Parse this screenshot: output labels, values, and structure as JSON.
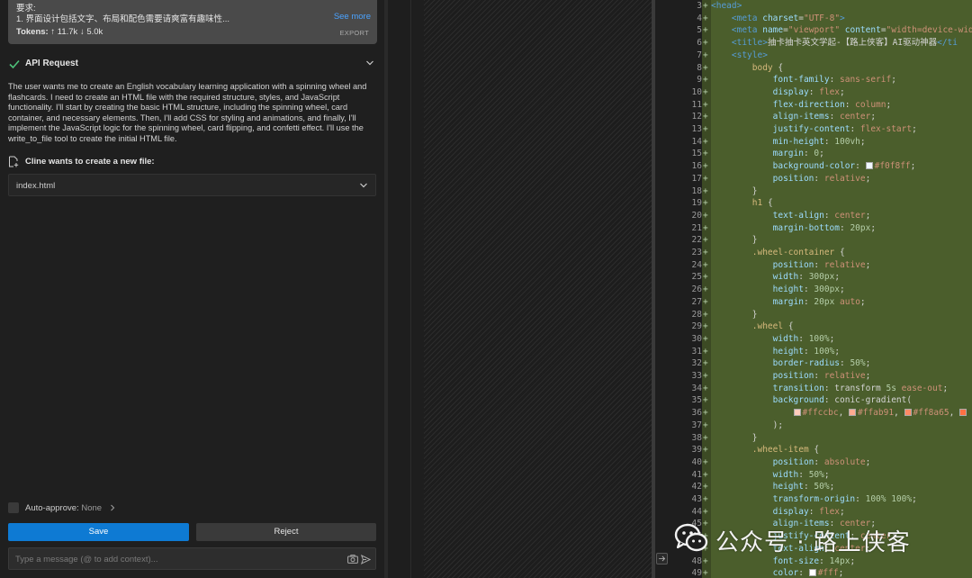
{
  "task": {
    "requirement_label": "要求:",
    "requirement_line": "1. 界面设计包括文字、布局和配色需要请爽富有趣味性...",
    "see_more": "See more",
    "tokens_label": "Tokens:",
    "tokens_up": "↑ 11.7k",
    "tokens_down": "↓ 5.0k",
    "export": "EXPORT"
  },
  "api_request": {
    "title": "API Request",
    "status_icon": "check-icon",
    "text": "The user wants me to create an English vocabulary learning application with a spinning wheel and flashcards. I need to create an HTML file with the required structure, styles, and JavaScript functionality. I'll start by creating the basic HTML structure, including the spinning wheel, card container, and necessary elements. Then, I'll add CSS for styling and animations, and finally, I'll implement the JavaScript logic for the spinning wheel, card flipping, and confetti effect. I'll use the write_to_file tool to create the initial HTML file."
  },
  "new_file": {
    "title": "Cline wants to create a new file:",
    "filename": "index.html"
  },
  "auto_approve": {
    "label": "Auto-approve:",
    "value": "None"
  },
  "actions": {
    "save": "Save",
    "reject": "Reject"
  },
  "message": {
    "placeholder": "Type a message (@ to add context)..."
  },
  "colors": {
    "accent": "#0e7ad3",
    "added_line": "#4b5e2c",
    "check": "#4ec27a",
    "link": "#4aa3ff"
  },
  "code": [
    {
      "n": "3+",
      "tokens": [
        [
          "t-tag",
          "<head>"
        ]
      ]
    },
    {
      "n": "4+",
      "tokens": [
        [
          "t-text",
          "    "
        ],
        [
          "t-tag",
          "<meta "
        ],
        [
          "t-attr",
          "charset"
        ],
        [
          "t-punc",
          "="
        ],
        [
          "t-str",
          "\"UTF-8\""
        ],
        [
          "t-tag",
          ">"
        ]
      ]
    },
    {
      "n": "5+",
      "tokens": [
        [
          "t-text",
          "    "
        ],
        [
          "t-tag",
          "<meta "
        ],
        [
          "t-attr",
          "name"
        ],
        [
          "t-punc",
          "="
        ],
        [
          "t-str",
          "\"viewport\" "
        ],
        [
          "t-attr",
          "content"
        ],
        [
          "t-punc",
          "="
        ],
        [
          "t-str",
          "\"width=device-wid"
        ]
      ]
    },
    {
      "n": "6+",
      "tokens": [
        [
          "t-text",
          "    "
        ],
        [
          "t-tag",
          "<title>"
        ],
        [
          "t-text",
          "抽卡抽卡英文学起-【路上侠客】AI驱动神器"
        ],
        [
          "t-tag",
          "</ti"
        ]
      ]
    },
    {
      "n": "7+",
      "tokens": [
        [
          "t-text",
          "    "
        ],
        [
          "t-tag",
          "<style>"
        ]
      ]
    },
    {
      "n": "8+",
      "tokens": [
        [
          "t-text",
          "        "
        ],
        [
          "t-sel",
          "body"
        ],
        [
          "t-punc",
          " {"
        ]
      ]
    },
    {
      "n": "9+",
      "tokens": [
        [
          "t-text",
          "            "
        ],
        [
          "t-prop",
          "font-family"
        ],
        [
          "t-punc",
          ": "
        ],
        [
          "t-val",
          "sans-serif"
        ],
        [
          "t-punc",
          ";"
        ]
      ]
    },
    {
      "n": "10+",
      "tokens": [
        [
          "t-text",
          "            "
        ],
        [
          "t-prop",
          "display"
        ],
        [
          "t-punc",
          ": "
        ],
        [
          "t-val",
          "flex"
        ],
        [
          "t-punc",
          ";"
        ]
      ]
    },
    {
      "n": "11+",
      "tokens": [
        [
          "t-text",
          "            "
        ],
        [
          "t-prop",
          "flex-direction"
        ],
        [
          "t-punc",
          ": "
        ],
        [
          "t-val",
          "column"
        ],
        [
          "t-punc",
          ";"
        ]
      ]
    },
    {
      "n": "12+",
      "tokens": [
        [
          "t-text",
          "            "
        ],
        [
          "t-prop",
          "align-items"
        ],
        [
          "t-punc",
          ": "
        ],
        [
          "t-val",
          "center"
        ],
        [
          "t-punc",
          ";"
        ]
      ]
    },
    {
      "n": "13+",
      "tokens": [
        [
          "t-text",
          "            "
        ],
        [
          "t-prop",
          "justify-content"
        ],
        [
          "t-punc",
          ": "
        ],
        [
          "t-val",
          "flex-start"
        ],
        [
          "t-punc",
          ";"
        ]
      ]
    },
    {
      "n": "14+",
      "tokens": [
        [
          "t-text",
          "            "
        ],
        [
          "t-prop",
          "min-height"
        ],
        [
          "t-punc",
          ": "
        ],
        [
          "t-num",
          "100vh"
        ],
        [
          "t-punc",
          ";"
        ]
      ]
    },
    {
      "n": "15+",
      "tokens": [
        [
          "t-text",
          "            "
        ],
        [
          "t-prop",
          "margin"
        ],
        [
          "t-punc",
          ": "
        ],
        [
          "t-num",
          "0"
        ],
        [
          "t-punc",
          ";"
        ]
      ]
    },
    {
      "n": "16+",
      "tokens": [
        [
          "t-text",
          "            "
        ],
        [
          "t-prop",
          "background-color"
        ],
        [
          "t-punc",
          ": "
        ],
        [
          "swatch",
          "#f0f8ff"
        ],
        [
          "t-val",
          "#f0f8ff"
        ],
        [
          "t-punc",
          ";"
        ]
      ]
    },
    {
      "n": "17+",
      "tokens": [
        [
          "t-text",
          "            "
        ],
        [
          "t-prop",
          "position"
        ],
        [
          "t-punc",
          ": "
        ],
        [
          "t-val",
          "relative"
        ],
        [
          "t-punc",
          ";"
        ]
      ]
    },
    {
      "n": "18+",
      "tokens": [
        [
          "t-text",
          "        "
        ],
        [
          "t-punc",
          "}"
        ]
      ]
    },
    {
      "n": "19+",
      "tokens": [
        [
          "t-text",
          "        "
        ],
        [
          "t-sel",
          "h1"
        ],
        [
          "t-punc",
          " {"
        ]
      ]
    },
    {
      "n": "20+",
      "tokens": [
        [
          "t-text",
          "            "
        ],
        [
          "t-prop",
          "text-align"
        ],
        [
          "t-punc",
          ": "
        ],
        [
          "t-val",
          "center"
        ],
        [
          "t-punc",
          ";"
        ]
      ]
    },
    {
      "n": "21+",
      "tokens": [
        [
          "t-text",
          "            "
        ],
        [
          "t-prop",
          "margin-bottom"
        ],
        [
          "t-punc",
          ": "
        ],
        [
          "t-num",
          "20px"
        ],
        [
          "t-punc",
          ";"
        ]
      ]
    },
    {
      "n": "22+",
      "tokens": [
        [
          "t-text",
          "        "
        ],
        [
          "t-punc",
          "}"
        ]
      ]
    },
    {
      "n": "23+",
      "tokens": [
        [
          "t-text",
          "        "
        ],
        [
          "t-sel",
          ".wheel-container"
        ],
        [
          "t-punc",
          " {"
        ]
      ]
    },
    {
      "n": "24+",
      "tokens": [
        [
          "t-text",
          "            "
        ],
        [
          "t-prop",
          "position"
        ],
        [
          "t-punc",
          ": "
        ],
        [
          "t-val",
          "relative"
        ],
        [
          "t-punc",
          ";"
        ]
      ]
    },
    {
      "n": "25+",
      "tokens": [
        [
          "t-text",
          "            "
        ],
        [
          "t-prop",
          "width"
        ],
        [
          "t-punc",
          ": "
        ],
        [
          "t-num",
          "300px"
        ],
        [
          "t-punc",
          ";"
        ]
      ]
    },
    {
      "n": "26+",
      "tokens": [
        [
          "t-text",
          "            "
        ],
        [
          "t-prop",
          "height"
        ],
        [
          "t-punc",
          ": "
        ],
        [
          "t-num",
          "300px"
        ],
        [
          "t-punc",
          ";"
        ]
      ]
    },
    {
      "n": "27+",
      "tokens": [
        [
          "t-text",
          "            "
        ],
        [
          "t-prop",
          "margin"
        ],
        [
          "t-punc",
          ": "
        ],
        [
          "t-num",
          "20px "
        ],
        [
          "t-val",
          "auto"
        ],
        [
          "t-punc",
          ";"
        ]
      ]
    },
    {
      "n": "28+",
      "tokens": [
        [
          "t-text",
          "        "
        ],
        [
          "t-punc",
          "}"
        ]
      ]
    },
    {
      "n": "29+",
      "tokens": [
        [
          "t-text",
          "        "
        ],
        [
          "t-sel",
          ".wheel"
        ],
        [
          "t-punc",
          " {"
        ]
      ]
    },
    {
      "n": "30+",
      "tokens": [
        [
          "t-text",
          "            "
        ],
        [
          "t-prop",
          "width"
        ],
        [
          "t-punc",
          ": "
        ],
        [
          "t-num",
          "100%"
        ],
        [
          "t-punc",
          ";"
        ]
      ]
    },
    {
      "n": "31+",
      "tokens": [
        [
          "t-text",
          "            "
        ],
        [
          "t-prop",
          "height"
        ],
        [
          "t-punc",
          ": "
        ],
        [
          "t-num",
          "100%"
        ],
        [
          "t-punc",
          ";"
        ]
      ]
    },
    {
      "n": "32+",
      "tokens": [
        [
          "t-text",
          "            "
        ],
        [
          "t-prop",
          "border-radius"
        ],
        [
          "t-punc",
          ": "
        ],
        [
          "t-num",
          "50%"
        ],
        [
          "t-punc",
          ";"
        ]
      ]
    },
    {
      "n": "33+",
      "tokens": [
        [
          "t-text",
          "            "
        ],
        [
          "t-prop",
          "position"
        ],
        [
          "t-punc",
          ": "
        ],
        [
          "t-val",
          "relative"
        ],
        [
          "t-punc",
          ";"
        ]
      ]
    },
    {
      "n": "34+",
      "tokens": [
        [
          "t-text",
          "            "
        ],
        [
          "t-prop",
          "transition"
        ],
        [
          "t-punc",
          ": "
        ],
        [
          "t-text",
          "transform "
        ],
        [
          "t-num",
          "5s "
        ],
        [
          "t-val",
          "ease-out"
        ],
        [
          "t-punc",
          ";"
        ]
      ]
    },
    {
      "n": "35+",
      "tokens": [
        [
          "t-text",
          "            "
        ],
        [
          "t-prop",
          "background"
        ],
        [
          "t-punc",
          ": "
        ],
        [
          "t-text",
          "conic-gradient("
        ]
      ]
    },
    {
      "n": "36+",
      "tokens": [
        [
          "t-text",
          "                "
        ],
        [
          "swatch",
          "#ffccbc"
        ],
        [
          "t-val",
          "#ffccbc"
        ],
        [
          "t-punc",
          ", "
        ],
        [
          "swatch",
          "#ffab91"
        ],
        [
          "t-val",
          "#ffab91"
        ],
        [
          "t-punc",
          ", "
        ],
        [
          "swatch",
          "#ff8a65"
        ],
        [
          "t-val",
          "#ff8a65"
        ],
        [
          "t-punc",
          ", "
        ],
        [
          "swatch",
          "#ff7043"
        ]
      ]
    },
    {
      "n": "37+",
      "tokens": [
        [
          "t-text",
          "            "
        ],
        [
          "t-punc",
          ");"
        ]
      ]
    },
    {
      "n": "38+",
      "tokens": [
        [
          "t-text",
          "        "
        ],
        [
          "t-punc",
          "}"
        ]
      ]
    },
    {
      "n": "39+",
      "tokens": [
        [
          "t-text",
          "        "
        ],
        [
          "t-sel",
          ".wheel-item"
        ],
        [
          "t-punc",
          " {"
        ]
      ]
    },
    {
      "n": "40+",
      "tokens": [
        [
          "t-text",
          "            "
        ],
        [
          "t-prop",
          "position"
        ],
        [
          "t-punc",
          ": "
        ],
        [
          "t-val",
          "absolute"
        ],
        [
          "t-punc",
          ";"
        ]
      ]
    },
    {
      "n": "41+",
      "tokens": [
        [
          "t-text",
          "            "
        ],
        [
          "t-prop",
          "width"
        ],
        [
          "t-punc",
          ": "
        ],
        [
          "t-num",
          "50%"
        ],
        [
          "t-punc",
          ";"
        ]
      ]
    },
    {
      "n": "42+",
      "tokens": [
        [
          "t-text",
          "            "
        ],
        [
          "t-prop",
          "height"
        ],
        [
          "t-punc",
          ": "
        ],
        [
          "t-num",
          "50%"
        ],
        [
          "t-punc",
          ";"
        ]
      ]
    },
    {
      "n": "43+",
      "tokens": [
        [
          "t-text",
          "            "
        ],
        [
          "t-prop",
          "transform-origin"
        ],
        [
          "t-punc",
          ": "
        ],
        [
          "t-num",
          "100% 100%"
        ],
        [
          "t-punc",
          ";"
        ]
      ]
    },
    {
      "n": "44+",
      "tokens": [
        [
          "t-text",
          "            "
        ],
        [
          "t-prop",
          "display"
        ],
        [
          "t-punc",
          ": "
        ],
        [
          "t-val",
          "flex"
        ],
        [
          "t-punc",
          ";"
        ]
      ]
    },
    {
      "n": "45+",
      "tokens": [
        [
          "t-text",
          "            "
        ],
        [
          "t-prop",
          "align-items"
        ],
        [
          "t-punc",
          ": "
        ],
        [
          "t-val",
          "center"
        ],
        [
          "t-punc",
          ";"
        ]
      ]
    },
    {
      "n": "46+",
      "tokens": [
        [
          "t-text",
          "            "
        ],
        [
          "t-prop",
          "justify-content"
        ],
        [
          "t-punc",
          ": "
        ],
        [
          "t-val",
          "center"
        ],
        [
          "t-punc",
          ";"
        ]
      ]
    },
    {
      "n": "47+",
      "tokens": [
        [
          "t-text",
          "            "
        ],
        [
          "t-prop",
          "text-align"
        ],
        [
          "t-punc",
          ": "
        ],
        [
          "t-val",
          "center"
        ],
        [
          "t-punc",
          ";"
        ]
      ]
    },
    {
      "n": "48+",
      "tokens": [
        [
          "t-text",
          "            "
        ],
        [
          "t-prop",
          "font-size"
        ],
        [
          "t-punc",
          ": "
        ],
        [
          "t-num",
          "14px"
        ],
        [
          "t-punc",
          ";"
        ]
      ]
    },
    {
      "n": "49+",
      "tokens": [
        [
          "t-text",
          "            "
        ],
        [
          "t-prop",
          "color"
        ],
        [
          "t-punc",
          ": "
        ],
        [
          "swatch",
          "#fff"
        ],
        [
          "t-val",
          "#fff"
        ],
        [
          "t-punc",
          ";"
        ]
      ]
    }
  ],
  "watermark": {
    "text": "公众号 · 路上侠客"
  }
}
